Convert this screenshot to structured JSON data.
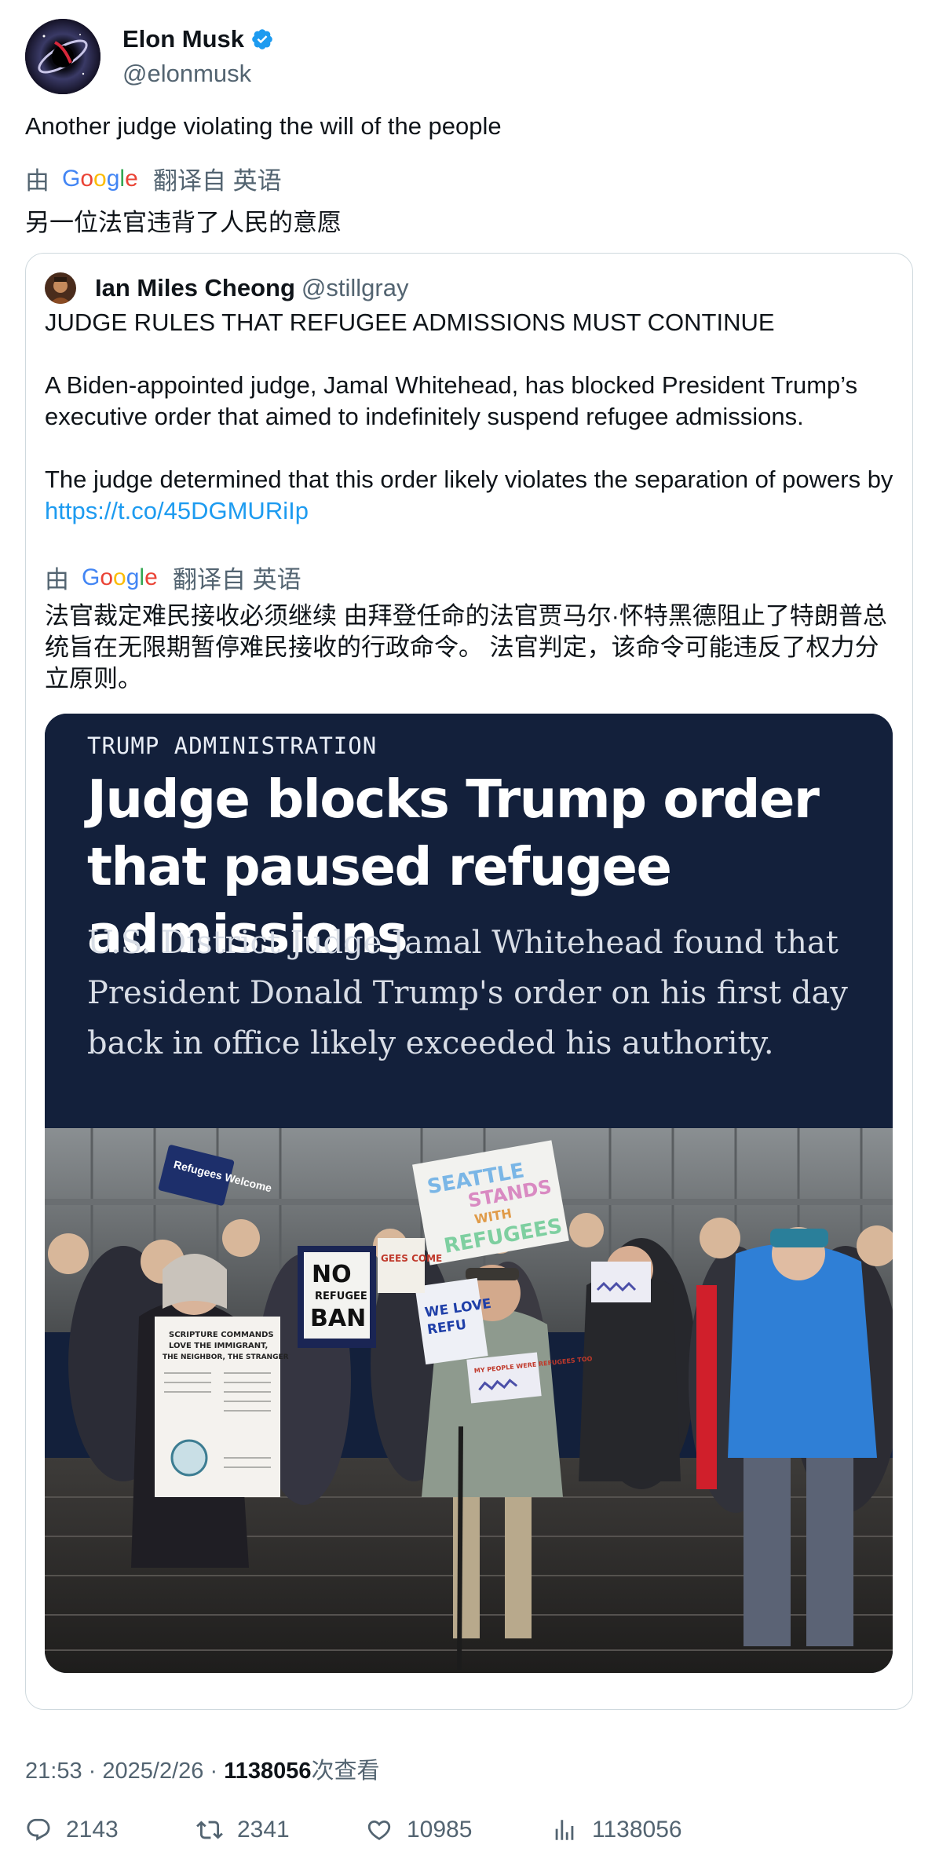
{
  "author": {
    "display_name": "Elon Musk",
    "handle": "@elonmusk",
    "verified": true,
    "avatar_icon": "black-hole-avatar"
  },
  "tweet": {
    "text": "Another judge violating the will of the people",
    "translate_prefix": "由",
    "translate_brand": "Google",
    "translate_suffix": "翻译自 英语",
    "translated_text": "另一位法官违背了人民的意愿"
  },
  "quoted": {
    "display_name": "Ian Miles Cheong",
    "handle": "@stillgray",
    "paragraphs": [
      "JUDGE RULES THAT REFUGEE ADMISSIONS MUST CONTINUE",
      "A Biden-appointed judge, Jamal Whitehead, has blocked President Trump’s executive order that aimed to indefinitely suspend refugee admissions."
    ],
    "last_paragraph_text": "The judge determined that this order likely violates the separation of powers by ",
    "link": "https://t.co/45DGMURiIp",
    "translate_prefix": "由",
    "translate_brand": "Google",
    "translate_suffix": "翻译自 英语",
    "translated_text": "法官裁定难民接收必须继续 由拜登任命的法官贾马尔·怀特黑德阻止了特朗普总统旨在无限期暂停难民接收的行政命令。 法官判定，该命令可能违反了权力分立原则。",
    "card": {
      "kicker": "TRUMP ADMINISTRATION",
      "headline": "Judge blocks Trump order that paused refugee admissions",
      "dek": "U.S. District Judge Jamal Whitehead found that President Donald Trump's order on his first day back in office likely exceeded his authority.",
      "signs": {
        "refugees_welcome": "Refugees Welcome",
        "seattle_1": "SEATTLE",
        "seattle_2": "STANDS",
        "seattle_3": "WITH",
        "seattle_4": "REFUGEES",
        "no_ban_1": "NO",
        "no_ban_2": "REFUGEE",
        "no_ban_3": "BAN",
        "we_love": "WE LOVE",
        "refu": "REFU",
        "scripture_1": "SCRIPTURE COMMANDS",
        "scripture_2": "LOVE THE IMMIGRANT,",
        "scripture_3": "THE NEIGHBOR, THE STRANGER",
        "my_people": "MY PEOPLE WERE REFUGEES TOO",
        "welcome_partial": "GEES COME"
      }
    }
  },
  "meta": {
    "time": "21:53",
    "separator": "·",
    "date": "2025/2/26",
    "views": "1138056",
    "views_suffix": "次查看"
  },
  "actions": {
    "replies": "2143",
    "reposts": "2341",
    "likes": "10985",
    "views": "1138056"
  },
  "colors": {
    "link": "#1d9bf0",
    "verified": "#1d9bf0",
    "secondary_text": "#536471",
    "card_background": "#13203b"
  }
}
